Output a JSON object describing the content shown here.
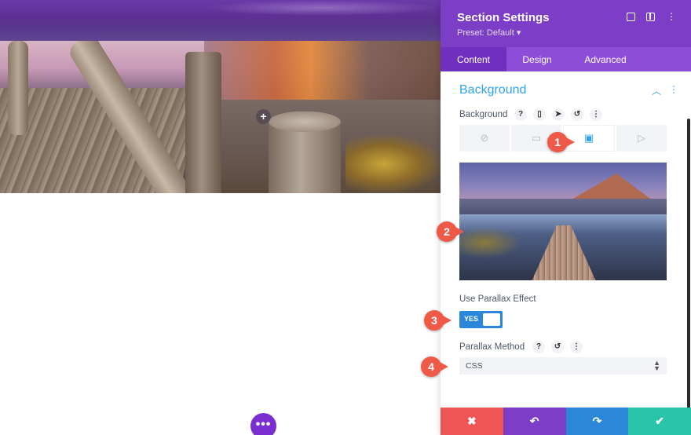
{
  "panel": {
    "title": "Section Settings",
    "preset": "Preset: Default ▾",
    "header_icons": [
      "fullscreen-icon",
      "split-view-icon",
      "more-vertical-icon"
    ]
  },
  "tabs": [
    {
      "label": "Content",
      "active": true
    },
    {
      "label": "Design",
      "active": false
    },
    {
      "label": "Advanced",
      "active": false
    }
  ],
  "background_section": {
    "heading": "Background",
    "field_label": "Background",
    "field_icons": {
      "help": "?",
      "phone": "▯",
      "pointer": "➤",
      "reset": "↺",
      "more": "⋮"
    },
    "bg_tabs": [
      {
        "name": "none-icon",
        "glyph": "⊘",
        "active": false
      },
      {
        "name": "gradient-icon",
        "glyph": "▭",
        "active": false
      },
      {
        "name": "image-icon",
        "glyph": "▣",
        "active": true
      },
      {
        "name": "video-icon",
        "glyph": "▷",
        "active": false
      }
    ]
  },
  "parallax": {
    "label": "Use Parallax Effect",
    "toggle_value": "YES",
    "method_label": "Parallax Method",
    "method_value": "CSS"
  },
  "footer": {
    "discard": "✖",
    "undo": "↶",
    "redo": "↷",
    "save": "✔"
  },
  "footer_colors": {
    "discard": "#ef5555",
    "undo": "#7c3ec7",
    "redo": "#2b87da",
    "save": "#29c4a9"
  },
  "callouts": [
    "1",
    "2",
    "3",
    "4"
  ],
  "canvas": {
    "add_row": "+",
    "more_button": "•••"
  }
}
